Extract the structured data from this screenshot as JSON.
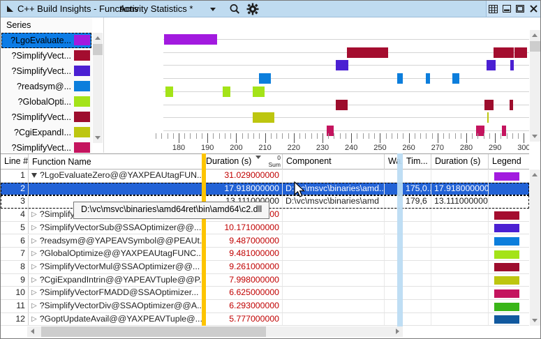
{
  "window": {
    "title": "C++ Build Insights - Functions",
    "tab_selector": "Activity Statistics *",
    "buttons": [
      "window-position-icon",
      "minimize-icon",
      "maximize-icon",
      "close-icon"
    ],
    "toolbar_icons": [
      "search-icon",
      "gear-icon"
    ]
  },
  "colors": {
    "titlebar": "#bfdbf0",
    "table_selection": "#2262d6",
    "series_selection": "#0c7ce6",
    "value_red": "#c00000",
    "frozen_splitter_yellow": "#fdc400",
    "column_strip_blue": "#bcdcf3"
  },
  "series_panel": {
    "header": "Series",
    "items": [
      {
        "label": "?LgoEvaluate...",
        "color": "#a21adf",
        "selected": true
      },
      {
        "label": "?SimplifyVect...",
        "color": "#a40d2f",
        "selected": false
      },
      {
        "label": "?SimplifyVect...",
        "color": "#4b20d2",
        "selected": false
      },
      {
        "label": "?readsym@...",
        "color": "#0c7edc",
        "selected": false
      },
      {
        "label": "?GlobalOpti...",
        "color": "#a4e318",
        "selected": false
      },
      {
        "label": "?SimplifyVect...",
        "color": "#9d0d2d",
        "selected": false
      },
      {
        "label": "?CgiExpandI...",
        "color": "#bdc60f",
        "selected": false
      },
      {
        "label": "?SimplifyVect...",
        "color": "#c4145e",
        "selected": false
      }
    ]
  },
  "chart_data": {
    "type": "gantt",
    "x_axis": {
      "unit": "seconds",
      "min": 172,
      "max": 302,
      "major_ticks": [
        180,
        190,
        200,
        210,
        220,
        230,
        240,
        250,
        260,
        270,
        280,
        290,
        300
      ],
      "minor_tick_step": 2,
      "grid": "per-row horizontal lines"
    },
    "legend_position": "left series panel",
    "series": [
      {
        "name": "?LgoEvaluate...",
        "color": "#a21adf",
        "bars": [
          [
            175.0,
            193.3
          ]
        ]
      },
      {
        "name": "?SimplifyVect...",
        "color": "#a40d2f",
        "bars": [
          [
            238.5,
            252.8
          ],
          [
            289.5,
            296.5
          ],
          [
            296.8,
            301.1
          ]
        ]
      },
      {
        "name": "?SimplifyVect...",
        "color": "#4b20d2",
        "bars": [
          [
            234.6,
            239.0
          ],
          [
            287.0,
            290.2
          ],
          [
            295.3,
            296.5
          ]
        ]
      },
      {
        "name": "?readsym@...",
        "color": "#0c7edc",
        "bars": [
          [
            207.9,
            212.0
          ],
          [
            256.0,
            258.0
          ],
          [
            265.9,
            267.4
          ],
          [
            275.1,
            277.6
          ]
        ]
      },
      {
        "name": "?GlobalOpti...",
        "color": "#a4e318",
        "bars": [
          [
            175.4,
            178.1
          ],
          [
            195.3,
            198.0
          ],
          [
            205.7,
            209.9
          ]
        ]
      },
      {
        "name": "?SimplifyVect...",
        "color": "#9d0d2d",
        "bars": [
          [
            234.6,
            238.7
          ],
          [
            286.3,
            289.5
          ],
          [
            295.0,
            296.3
          ]
        ]
      },
      {
        "name": "?CgiExpandI...",
        "color": "#bdc60f",
        "bars": [
          [
            205.7,
            213.3
          ],
          [
            287.3,
            287.8
          ]
        ]
      },
      {
        "name": "?SimplifyVect...",
        "color": "#c4145e",
        "bars": [
          [
            231.5,
            233.9
          ],
          [
            283.4,
            286.3
          ],
          [
            292.4,
            293.8
          ]
        ]
      }
    ]
  },
  "table": {
    "columns": [
      "Line #",
      "Function Name",
      "Duration (s)",
      "Component",
      "Wa...",
      "Tim...",
      "Duration (s)",
      "Legend"
    ],
    "duration_header": {
      "sort_order": "0",
      "aggregation": "Sum"
    },
    "rows": [
      {
        "line": "1",
        "expander": "open",
        "name": "?LgoEvaluateZero@@YAXPEAUtagFUN...",
        "dur": "31.029000000",
        "red": true,
        "comp": "",
        "tim": "",
        "dur2": "",
        "legend": "#a21adf",
        "selected": false,
        "dashed": false
      },
      {
        "line": "2",
        "expander": null,
        "name": "",
        "dur": "17.918000000",
        "red": false,
        "comp": "D:\\vc\\msvc\\binaries\\amd...",
        "tim": "175,0...",
        "dur2": "17.918000000",
        "legend": null,
        "selected": true,
        "dashed": false
      },
      {
        "line": "3",
        "expander": null,
        "name": "",
        "dur": "13.111000000",
        "red": false,
        "comp": "D:\\vc\\msvc\\binaries\\amd",
        "tim": "179,6",
        "dur2": "13.111000000",
        "legend": null,
        "selected": false,
        "dashed": true
      },
      {
        "line": "4",
        "expander": "closed",
        "name": "?SimplifyVectorAdd@SSAOptimizer@@...",
        "dur": "30.872000000",
        "red": true,
        "comp": "",
        "tim": "",
        "dur2": "",
        "legend": "#a40d2f",
        "selected": false,
        "dashed": false
      },
      {
        "line": "5",
        "expander": "closed",
        "name": "?SimplifyVectorSub@SSAOptimizer@@...",
        "dur": "10.171000000",
        "red": true,
        "comp": "",
        "tim": "",
        "dur2": "",
        "legend": "#4b20d2",
        "selected": false,
        "dashed": false
      },
      {
        "line": "6",
        "expander": "closed",
        "name": "?readsym@@YAPEAVSymbol@@PEAUt...",
        "dur": "9.487000000",
        "red": true,
        "comp": "",
        "tim": "",
        "dur2": "",
        "legend": "#0c7edc",
        "selected": false,
        "dashed": false
      },
      {
        "line": "7",
        "expander": "closed",
        "name": "?GlobalOptimize@@YAXPEAUtagFUNC...",
        "dur": "9.481000000",
        "red": true,
        "comp": "",
        "tim": "",
        "dur2": "",
        "legend": "#a4e318",
        "selected": false,
        "dashed": false
      },
      {
        "line": "8",
        "expander": "closed",
        "name": "?SimplifyVectorMul@SSAOptimizer@@...",
        "dur": "9.261000000",
        "red": true,
        "comp": "",
        "tim": "",
        "dur2": "",
        "legend": "#9d0d2d",
        "selected": false,
        "dashed": false
      },
      {
        "line": "9",
        "expander": "closed",
        "name": "?CgiExpandIntrin@@YAPEAVTuple@@P...",
        "dur": "7.998000000",
        "red": true,
        "comp": "",
        "tim": "",
        "dur2": "",
        "legend": "#bdc60f",
        "selected": false,
        "dashed": false
      },
      {
        "line": "10",
        "expander": "closed",
        "name": "?SimplifyVectorFMADD@SSAOptimizer...",
        "dur": "6.625000000",
        "red": true,
        "comp": "",
        "tim": "",
        "dur2": "",
        "legend": "#c4145e",
        "selected": false,
        "dashed": false
      },
      {
        "line": "11",
        "expander": "closed",
        "name": "?SimplifyVectorDiv@SSAOptimizer@@A...",
        "dur": "6.293000000",
        "red": true,
        "comp": "",
        "tim": "",
        "dur2": "",
        "legend": "#3ab519",
        "selected": false,
        "dashed": false
      },
      {
        "line": "12",
        "expander": "closed",
        "name": "?GoptUpdateAvail@@YAXPEAVTuple@...",
        "dur": "5.777000000",
        "red": true,
        "comp": "",
        "tim": "",
        "dur2": "",
        "legend": "#11599f",
        "selected": false,
        "dashed": false
      }
    ]
  },
  "tooltip": {
    "text": "D:\\vc\\msvc\\binaries\\amd64ret\\bin\\amd64\\c2.dll"
  }
}
